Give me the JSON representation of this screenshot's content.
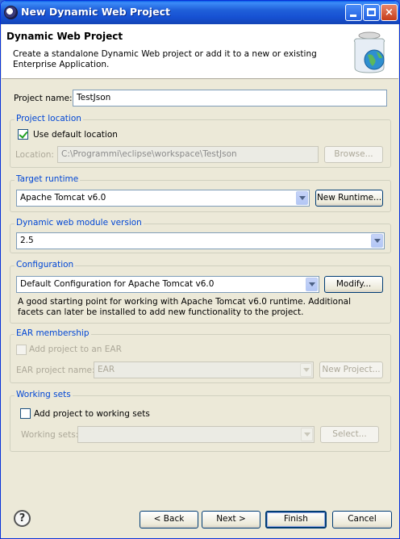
{
  "window": {
    "title": "New Dynamic Web Project",
    "controls": {
      "minimize": "minimize-icon",
      "maximize": "maximize-icon",
      "close": "×"
    }
  },
  "banner": {
    "title": "Dynamic Web Project",
    "description": "Create a standalone Dynamic Web project or add it to a new or existing Enterprise Application."
  },
  "project_name": {
    "label": "Project name:",
    "value": "TestJson"
  },
  "project_location": {
    "title": "Project location",
    "use_default_label": "Use default location",
    "use_default_checked": true,
    "location_label": "Location:",
    "location_value": "C:\\Programmi\\eclipse\\workspace\\TestJson",
    "browse_label": "Browse..."
  },
  "target_runtime": {
    "title": "Target runtime",
    "value": "Apache Tomcat v6.0",
    "new_runtime_label": "New Runtime..."
  },
  "module_version": {
    "title": "Dynamic web module version",
    "value": "2.5"
  },
  "configuration": {
    "title": "Configuration",
    "value": "Default Configuration for Apache Tomcat v6.0",
    "modify_label": "Modify...",
    "description": "A good starting point for working with Apache Tomcat v6.0 runtime. Additional facets can later be installed to add new functionality to the project."
  },
  "ear": {
    "title": "EAR membership",
    "add_label": "Add project to an EAR",
    "project_name_label": "EAR project name:",
    "project_name_value": "EAR",
    "new_project_label": "New Project..."
  },
  "working_sets": {
    "title": "Working sets",
    "add_label": "Add project to working sets",
    "sets_label": "Working sets:",
    "select_label": "Select..."
  },
  "footer": {
    "help": "?",
    "back_label": "< Back",
    "next_label": "Next >",
    "finish_label": "Finish",
    "cancel_label": "Cancel"
  }
}
